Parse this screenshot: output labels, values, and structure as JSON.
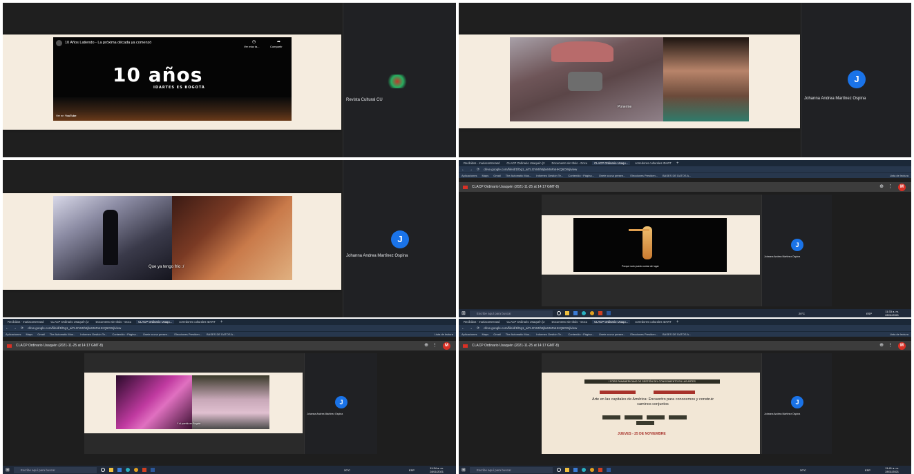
{
  "q1": {
    "video_title": "10 Años Latiendo - La próxima década ya comenzó",
    "video_actions": [
      "Ver más ta...",
      "Compartir"
    ],
    "headline": "10 años",
    "subheadline": "IDARTES ES BOGOTÁ",
    "watch_on": "Ver en",
    "youtube": "YouTube",
    "participant_name": "Revista Cultural CU"
  },
  "q2": {
    "participant_initial": "J",
    "participant_name": "Johanna Andrea Martínez Ospina",
    "video_caption": "Ponerme"
  },
  "q3": {
    "caption": "Que ya tengo frío :/",
    "participant_initial": "J",
    "participant_name": "Johanna Andrea Martínez Ospina"
  },
  "q4": {
    "tabs": [
      "Recibidos - mariacontrerasd",
      "CLACP Ordinario Usaquén (2",
      "Documento sin título - Docu",
      "CLACP Ordinario Usaqu...",
      "corredores culturales IDART"
    ],
    "url": "drive.google.com/file/d/1fDg1_aiTLGVMrh9jbvMnRxHKQ6OWj/view",
    "bookmarks": [
      "Aplicaciones",
      "Maps",
      "Gmail",
      "The Automatic Mus...",
      "Informes Gestión Te...",
      "Contenido › Página...",
      "Únete a una presen...",
      "Elecciones Presiden...",
      "BASES DE DATOS A...",
      "Lista de lectura"
    ],
    "drive_title": "CLACP Ordinario Usaquén (2021-11-25 at 14:17 GMT-8)",
    "user_initial": "M",
    "caption": "Porque solo puedo contar de lugar",
    "participant_initial": "J",
    "participant_name": "Johanna Andrea Martínez Ospina",
    "search_placeholder": "Escribe aquí para buscar",
    "temperature": "20°C",
    "lang": "ESP",
    "time": "11:33 a. m.",
    "date": "28/11/2021"
  },
  "q5": {
    "tabs": [
      "Recibidos - mariacontrerasd",
      "CLACP Ordinario Usaquén (2",
      "Documento sin título - Docu",
      "CLACP Ordinario Usaqu...",
      "corredores culturales IDART"
    ],
    "url": "drive.google.com/file/d/1fDg1_aiTLGVMrh9jbvMnRxHKQ6OWj/view",
    "bookmarks": [
      "Aplicaciones",
      "Maps",
      "Gmail",
      "The Automatic Mus...",
      "Informes Gestión Te...",
      "Contenido › Página...",
      "Únete a una presen...",
      "Elecciones Presiden...",
      "BASES DE DATOS A...",
      "Lista de lectura"
    ],
    "drive_title": "CLACP Ordinario Usaquén (2021-11-25 at 14:17 GMT-8)",
    "user_initial": "M",
    "caption": "Y al pueblo en Bogotá",
    "participant_initial": "J",
    "participant_name": "Johanna Andrea Martínez Ospina",
    "search_placeholder": "Escribe aquí para buscar",
    "temperature": "20°C",
    "lang": "ESP",
    "time": "11:34 a. m.",
    "date": "28/11/2021"
  },
  "q6": {
    "tabs": [
      "Recibidos - mariacontrerasd",
      "CLACP Ordinario Usaquén (2",
      "Documento sin título - Docu",
      "CLACP Ordinario Usaqu...",
      "corredores culturales IDART"
    ],
    "url": "drive.google.com/file/d/1fDg1_aiTLGVMrh9jbvMnRxHKQ6OWj/view",
    "bookmarks": [
      "Aplicaciones",
      "Maps",
      "Gmail",
      "The Automatic Mus...",
      "Informes Gestión Te...",
      "Contenido › Página...",
      "Únete a una presen...",
      "Elecciones Presiden...",
      "BASES DE DATOS A...",
      "Lista de lectura"
    ],
    "drive_title": "CLACP Ordinario Usaquén (2021-11-25 at 14:17 GMT-8)",
    "user_initial": "M",
    "forum_title": "I FORO PANAMERICANO DE GESTIÓN DEL CONOCIMIENTO EN LAS ARTES",
    "main_text": "Arte en las capitales de América: Encuentro para conocernos y construir caminos conjuntos",
    "day_label": "JUEVES - 25 DE NOVIEMBRE",
    "participant_initial": "J",
    "participant_name": "Johanna Andrea Martínez Ospina",
    "search_placeholder": "Escribe aquí para buscar",
    "temperature": "20°C",
    "lang": "ESP",
    "time": "11:41 a. m.",
    "date": "28/11/2021"
  },
  "colors": {
    "meet_bg": "#1f1f1f",
    "slide_bg": "#f5ecdf",
    "avatar_blue": "#1a73e8",
    "browser_dark": "#1b2838"
  }
}
